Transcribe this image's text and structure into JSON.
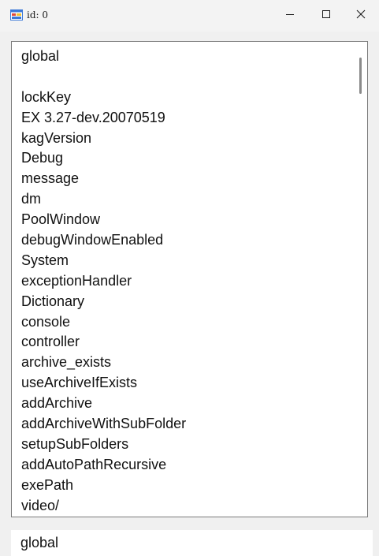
{
  "window": {
    "title": "id: 0",
    "minimize_glyph": "—",
    "maximize_glyph": "☐",
    "close_glyph": "✕"
  },
  "listbox": {
    "items": [
      "global",
      "",
      "lockKey",
      "EX 3.27-dev.20070519",
      "kagVersion",
      "Debug",
      "message",
      "dm",
      "PoolWindow",
      "debugWindowEnabled",
      "System",
      "exceptionHandler",
      "Dictionary",
      "console",
      "controller",
      "archive_exists",
      "useArchiveIfExists",
      "addArchive",
      "addArchiveWithSubFolder",
      "setupSubFolders",
      "addAutoPathRecursive",
      "exePath",
      "video/"
    ]
  },
  "input": {
    "value": "global"
  },
  "icons": {
    "app": "app-window-icon",
    "minimize": "minimize-icon",
    "maximize": "maximize-icon",
    "close": "close-icon"
  },
  "colors": {
    "icon_blue": "#3b78d8",
    "icon_red": "#e04a3a",
    "icon_yellow": "#f2c12e"
  }
}
